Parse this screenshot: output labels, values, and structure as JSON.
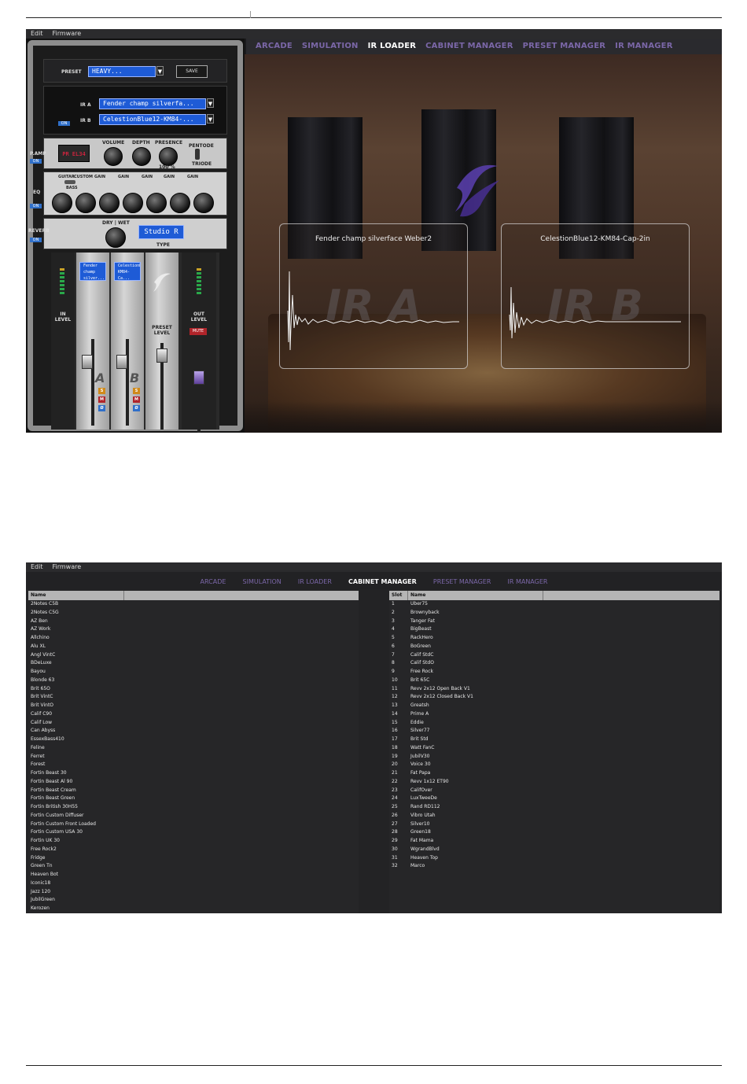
{
  "menu": {
    "edit": "Edit",
    "firmware": "Firmware"
  },
  "shot1": {
    "nav": [
      "ARCADE",
      "SIMULATION",
      "IR LOADER",
      "CABINET MANAGER",
      "PRESET MANAGER",
      "IR MANAGER"
    ],
    "active_tab": "IR LOADER",
    "preset": {
      "label": "PRESET",
      "value": "HEAVY...",
      "save": "SAVE"
    },
    "ir": {
      "ir_a_label": "IR A",
      "ir_a_value": "Fender champ silverfa...",
      "ir_b_label": "IR B",
      "ir_b_value": "CelestionBlue12-KM84-...",
      "on": "ON"
    },
    "pamp": {
      "label": "P.AMP",
      "on": "ON",
      "tube_display": "PR EL34",
      "volume": "VOLUME",
      "depth": "DEPTH",
      "presence": "PRESENCE",
      "pentode": "PENTODE",
      "triode": "TRIODE",
      "percent": "100 %"
    },
    "eq": {
      "label": "EQ",
      "on": "ON",
      "guitar": "GUITAR",
      "custom": "CUSTOM",
      "bass": "BASS",
      "gain": "GAIN"
    },
    "reverb": {
      "label": "REVERB",
      "on": "ON",
      "dry_wet": "DRY | WET",
      "type_value": "Studio R",
      "type_label": "TYPE"
    },
    "mixer": {
      "ir_a_screen": "Fender champ silver...",
      "ir_b_screen": "CelestionBlue12-KM84-Ca...",
      "in_level": "IN LEVEL",
      "out_level": "OUT LEVEL",
      "preset_level": "PRESET LEVEL",
      "mute": "MUTE",
      "a": "A",
      "b": "B",
      "s": "S",
      "m": "M",
      "phase": "Ø"
    },
    "panel_a": {
      "title": "Fender champ silverface Weber2",
      "watermark": "IR A"
    },
    "panel_b": {
      "title": "CelestionBlue12-KM84-Cap-2in",
      "watermark": "IR B"
    }
  },
  "shot2": {
    "nav": [
      "ARCADE",
      "SIMULATION",
      "IR LOADER",
      "CABINET MANAGER",
      "PRESET MANAGER",
      "IR MANAGER"
    ],
    "active_tab": "CABINET MANAGER",
    "left_header": {
      "name": "Name"
    },
    "left_rows": [
      "2Notes C5B",
      "2Notes C5G",
      "AZ Ben",
      "AZ Work",
      "Allchino",
      "Alu XL",
      "Angl VintC",
      "BDeLuxe",
      "Bayou",
      "Blonde 63",
      "Brit 65O",
      "Brit VintC",
      "Brit VintO",
      "Calif C90",
      "Calif Low",
      "Can Abyss",
      "EssexBass410",
      "Feline",
      "Ferret",
      "Forest",
      "Fortin Beast 30",
      "Fortin Beast Al 90",
      "Fortin Beast Cream",
      "Fortin Beast Green",
      "Fortin British 30H55",
      "Fortin Custom Diffuser",
      "Fortin Custom Front Loaded",
      "Fortin Custom USA 30",
      "Fortin UK 30",
      "Free Rock2",
      "Fridge",
      "Green Tn",
      "Heaven Bot",
      "Iconic18",
      "Jazz 120",
      "JubilGreen",
      "Kerozen"
    ],
    "right_header": {
      "slot": "Slot",
      "name": "Name"
    },
    "right_rows": [
      {
        "slot": "1",
        "name": "Uber75"
      },
      {
        "slot": "2",
        "name": "Brownyback"
      },
      {
        "slot": "3",
        "name": "Tanger Fat"
      },
      {
        "slot": "4",
        "name": "BigBeast"
      },
      {
        "slot": "5",
        "name": "RackHero"
      },
      {
        "slot": "6",
        "name": "BoGreen"
      },
      {
        "slot": "7",
        "name": "Calif StdC"
      },
      {
        "slot": "8",
        "name": "Calif StdO"
      },
      {
        "slot": "9",
        "name": "Free Rock"
      },
      {
        "slot": "10",
        "name": "Brit 65C"
      },
      {
        "slot": "11",
        "name": "Revv 2x12 Open Back V1"
      },
      {
        "slot": "12",
        "name": "Revv 2x12 Closed Back V1"
      },
      {
        "slot": "13",
        "name": "Greatsh"
      },
      {
        "slot": "14",
        "name": "Prime A"
      },
      {
        "slot": "15",
        "name": "Eddie"
      },
      {
        "slot": "16",
        "name": "Silver77"
      },
      {
        "slot": "17",
        "name": "Brit Std"
      },
      {
        "slot": "18",
        "name": "Watt FanC"
      },
      {
        "slot": "19",
        "name": "JubilV30"
      },
      {
        "slot": "20",
        "name": "Voice 30"
      },
      {
        "slot": "21",
        "name": "Fat Papa"
      },
      {
        "slot": "22",
        "name": "Revv 1x12 ET90"
      },
      {
        "slot": "23",
        "name": "CalifOver"
      },
      {
        "slot": "24",
        "name": "LuxTweeDe"
      },
      {
        "slot": "25",
        "name": "Rand RD112"
      },
      {
        "slot": "26",
        "name": "Vibro Utah"
      },
      {
        "slot": "27",
        "name": "Silver10"
      },
      {
        "slot": "28",
        "name": "Green18"
      },
      {
        "slot": "29",
        "name": "Fat Mama"
      },
      {
        "slot": "30",
        "name": "WgrandBlvd"
      },
      {
        "slot": "31",
        "name": "Heaven Top"
      },
      {
        "slot": "32",
        "name": "Marco"
      }
    ]
  },
  "colors": {
    "accent": "#7b67a8",
    "display_blue": "#1e5bd6",
    "on_blue": "#2f6fc9",
    "mute_red": "#b0242a",
    "solo_orange": "#d08a1a"
  }
}
